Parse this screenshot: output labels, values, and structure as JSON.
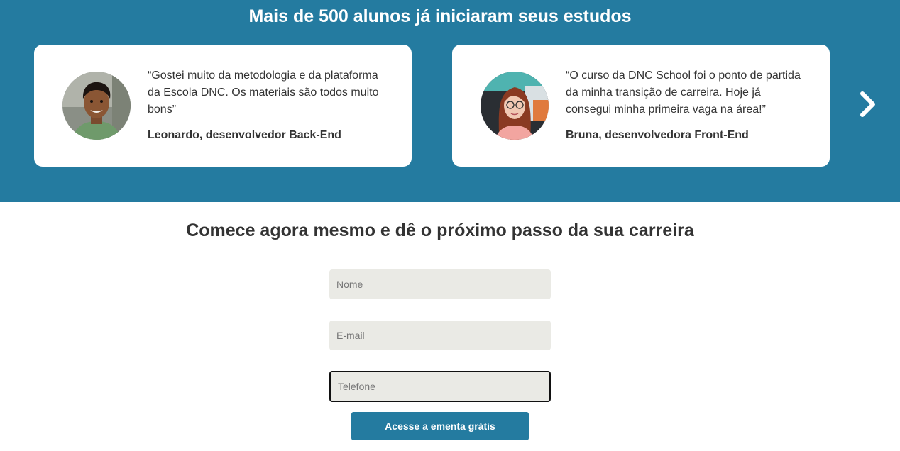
{
  "colors": {
    "accent": "#247ba0",
    "input_bg": "#eaeae5",
    "text": "#333333"
  },
  "testimonials": {
    "title": "Mais de 500 alunos já iniciaram seus estudos",
    "cards": [
      {
        "quote": "“Gostei muito da metodologia e da plataforma da Escola DNC. Os materiais são todos muito bons”",
        "author": "Leonardo, desenvolvedor Back-End",
        "avatar_icon": "student-photo-leonardo"
      },
      {
        "quote": "“O curso da DNC School foi o ponto de partida da minha transição de carreira. Hoje já consegui minha primeira vaga na área!”",
        "author": "Bruna, desenvolvedora Front-End",
        "avatar_icon": "student-photo-bruna"
      }
    ],
    "next_icon": "chevron-right-icon"
  },
  "signup": {
    "title": "Comece agora mesmo e dê o próximo passo da sua carreira",
    "fields": {
      "name_placeholder": "Nome",
      "email_placeholder": "E-mail",
      "phone_placeholder": "Telefone"
    },
    "submit_label": "Acesse a ementa grátis"
  }
}
